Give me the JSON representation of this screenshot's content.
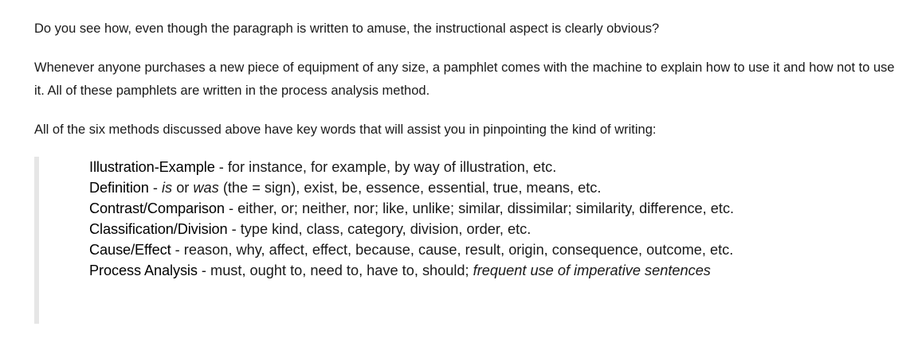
{
  "paragraphs": [
    "Do you see how, even though the paragraph is written to amuse, the instructional aspect is clearly obvious?",
    "Whenever anyone purchases a new piece of equipment of any size, a pamphlet comes with the machine to explain how to use it and how not to use it. All of these pamphlets are written in the process analysis method.",
    "All of the six methods discussed above have key words that will assist you in pinpointing the kind of writing:"
  ],
  "methods": {
    "illustration": {
      "term": "Illustration-Example",
      "text": " - for instance, for example, by way of illustration, etc."
    },
    "definition": {
      "term": "Definition",
      "pre": " - ",
      "is": "is",
      "or": " or ",
      "was": "was",
      "text": " (the = sign), exist, be, essence, essential, true, means, etc."
    },
    "contrast": {
      "term": "Contrast/Comparison",
      "text": " - either, or; neither, nor; like, unlike; similar, dissimilar; similarity, difference, etc."
    },
    "classification": {
      "term": "Classification/Division",
      "text": " - type kind, class, category, division, order, etc."
    },
    "cause": {
      "term": "Cause/Effect",
      "text": " - reason, why, affect, effect, because, cause, result, origin, consequence, outcome, etc."
    },
    "process": {
      "term": "Process Analysis",
      "text": " - must, ought to, need to, have to, should; ",
      "italic": "frequent use of imperative sentences"
    }
  }
}
